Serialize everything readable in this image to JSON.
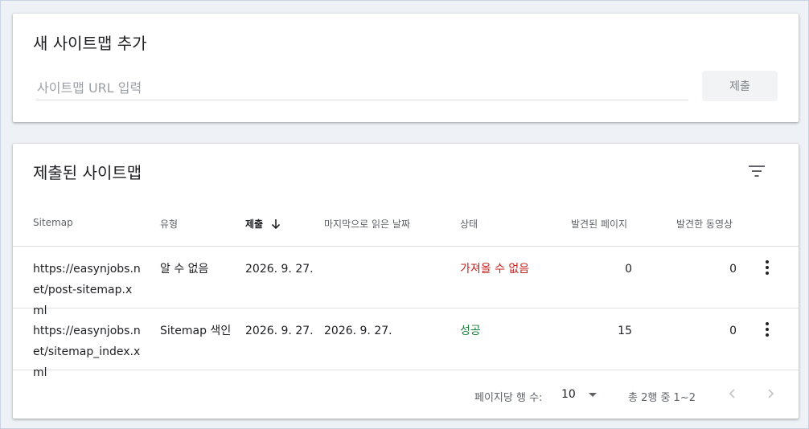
{
  "add_card": {
    "title": "새 사이트맵 추가",
    "input_placeholder": "사이트맵 URL 입력",
    "input_value": "",
    "submit_label": "제출"
  },
  "list_card": {
    "title": "제출된 사이트맵",
    "columns": {
      "sitemap": "Sitemap",
      "type": "유형",
      "submitted": "제출",
      "last_read": "마지막으로 읽은 날짜",
      "status": "상태",
      "discovered_pages": "발견된 페이지",
      "discovered_videos": "발견한 동영상"
    },
    "sort_column": "submitted",
    "sort_direction": "desc",
    "rows": [
      {
        "sitemap": "https://easynjobs.net/post-sitemap.xml",
        "type": "알 수 없음",
        "submitted": "2026. 9. 27.",
        "last_read": "",
        "status": "가져올 수 없음",
        "status_kind": "error",
        "pages": "0",
        "videos": "0"
      },
      {
        "sitemap": "https://easynjobs.net/sitemap_index.xml",
        "type": "Sitemap 색인",
        "submitted": "2026. 9. 27.",
        "last_read": "2026. 9. 27.",
        "status": "성공",
        "status_kind": "success",
        "pages": "15",
        "videos": "0"
      }
    ],
    "pagination": {
      "rows_per_page_label": "페이지당 행 수:",
      "rows_per_page_value": "10",
      "range_text": "총 2행 중 1~2"
    }
  },
  "colors": {
    "error": "#c5221f",
    "success": "#188038",
    "text": "#202124",
    "muted": "#5f6368"
  },
  "icons": [
    "filter-icon",
    "arrow-down-icon",
    "more-vert-icon",
    "dropdown-arrow-icon",
    "chevron-left-icon",
    "chevron-right-icon"
  ]
}
